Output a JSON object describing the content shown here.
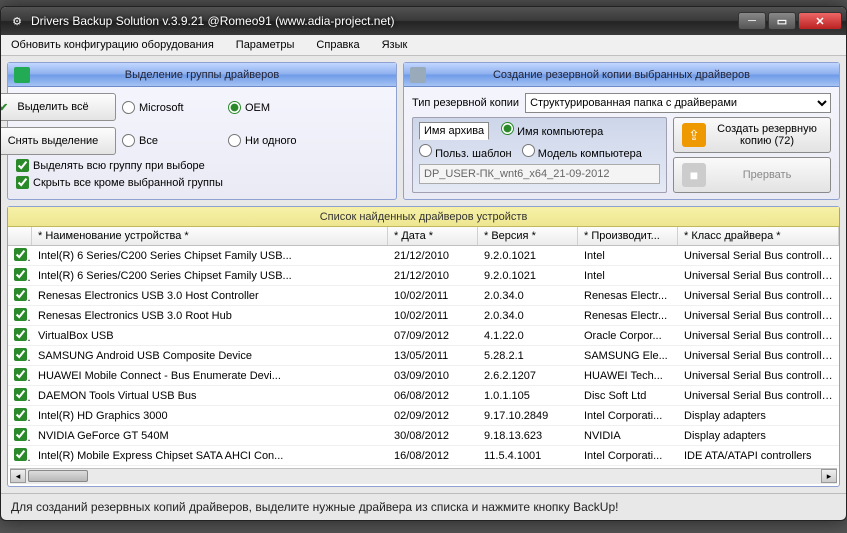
{
  "window": {
    "title": "Drivers Backup Solution v.3.9.21 @Romeo91 (www.adia-project.net)"
  },
  "menubar": {
    "refresh": "Обновить конфигурацию оборудования",
    "params": "Параметры",
    "help": "Справка",
    "lang": "Язык"
  },
  "left_panel": {
    "title": "Выделение группы драйверов",
    "r_ms": "Microsoft",
    "r_oem": "OEM",
    "r_all": "Все",
    "r_none": "Ни одного",
    "chk_selectgroup": "Выделять всю группу при выборе",
    "chk_hide": "Скрыть все кроме выбранной группы",
    "btn_selectall": "Выделить всё",
    "btn_deselect": "Снять выделение"
  },
  "right_panel": {
    "title": "Создание резервной копии выбранных драйверов",
    "type_label": "Тип резервной копии",
    "type_value": "Структурированная папка с драйверами",
    "tab_archive": "Имя архива",
    "opt_compname": "Имя компьютера",
    "opt_usertpl": "Польз. шаблон",
    "opt_model": "Модель компьютера",
    "archive_name": "DP_USER-ПК_wnt6_x64_21-09-2012",
    "btn_backup": "Создать резервную копию (72)",
    "btn_abort": "Прервать"
  },
  "list": {
    "title": "Список найденных драйверов устройств",
    "col_name": "* Наименование устройства *",
    "col_date": "* Дата *",
    "col_ver": "* Версия *",
    "col_vendor": "* Производит...",
    "col_class": "* Класс драйвера *",
    "rows": [
      {
        "n": "Intel(R) 6 Series/C200 Series Chipset Family USB...",
        "d": "21/12/2010",
        "v": "9.2.0.1021",
        "m": "Intel",
        "c": "Universal Serial Bus controllers"
      },
      {
        "n": "Intel(R) 6 Series/C200 Series Chipset Family USB...",
        "d": "21/12/2010",
        "v": "9.2.0.1021",
        "m": "Intel",
        "c": "Universal Serial Bus controllers"
      },
      {
        "n": "Renesas Electronics USB 3.0 Host Controller",
        "d": "10/02/2011",
        "v": "2.0.34.0",
        "m": "Renesas Electr...",
        "c": "Universal Serial Bus controllers"
      },
      {
        "n": "Renesas Electronics USB 3.0 Root Hub",
        "d": "10/02/2011",
        "v": "2.0.34.0",
        "m": "Renesas Electr...",
        "c": "Universal Serial Bus controllers"
      },
      {
        "n": "VirtualBox USB",
        "d": "07/09/2012",
        "v": "4.1.22.0",
        "m": "Oracle Corpor...",
        "c": "Universal Serial Bus controllers"
      },
      {
        "n": "SAMSUNG Android USB Composite Device",
        "d": "13/05/2011",
        "v": "5.28.2.1",
        "m": "SAMSUNG Ele...",
        "c": "Universal Serial Bus controllers"
      },
      {
        "n": "HUAWEI Mobile Connect - Bus Enumerate Devi...",
        "d": "03/09/2010",
        "v": "2.6.2.1207",
        "m": "HUAWEI Tech...",
        "c": "Universal Serial Bus controllers"
      },
      {
        "n": "DAEMON Tools Virtual USB Bus",
        "d": "06/08/2012",
        "v": "1.0.1.105",
        "m": "Disc Soft Ltd",
        "c": "Universal Serial Bus controllers"
      },
      {
        "n": "Intel(R) HD Graphics 3000",
        "d": "02/09/2012",
        "v": "9.17.10.2849",
        "m": "Intel Corporati...",
        "c": "Display adapters"
      },
      {
        "n": "NVIDIA GeForce GT 540M",
        "d": "30/08/2012",
        "v": "9.18.13.623",
        "m": "NVIDIA",
        "c": "Display adapters"
      },
      {
        "n": "Intel(R) Mobile Express Chipset SATA AHCI Con...",
        "d": "16/08/2012",
        "v": "11.5.4.1001",
        "m": "Intel Corporati...",
        "c": "IDE ATA/ATAPI controllers"
      }
    ]
  },
  "status": "Для созданий резервных копий драйверов, выделите нужные драйвера из списка и нажмите кнопку BackUp!"
}
